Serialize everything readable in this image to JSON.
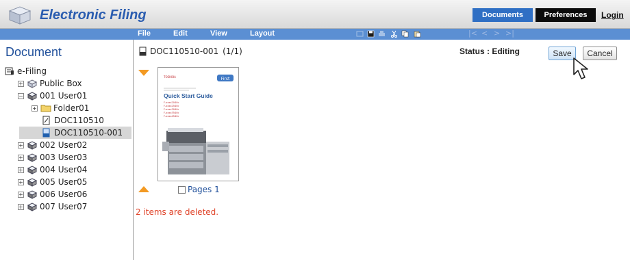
{
  "header": {
    "app_title": "Electronic Filing",
    "nav": {
      "documents": "Documents",
      "preferences": "Preferences",
      "login": "Login"
    },
    "colors": {
      "title_blue": "#2b5db0",
      "documents_tab": "#2f6fc4",
      "preferences_tab": "#0b0b0b"
    }
  },
  "menubar": {
    "items": [
      "File",
      "Edit",
      "View",
      "Layout"
    ],
    "toolbar_icons": [
      "unknown-icon",
      "save-icon",
      "print-icon",
      "cut-icon",
      "copy-icon",
      "paste-icon"
    ],
    "page_nav": [
      "|<",
      "<",
      ">",
      ">|"
    ],
    "color": "#5b8fd3"
  },
  "sidebar": {
    "title": "Document",
    "tree": [
      {
        "label": "e-Filing",
        "icon": "efiling-icon",
        "expander": ""
      },
      {
        "label": "Public Box",
        "icon": "box-icon",
        "expander": "+"
      },
      {
        "label": "001 User01",
        "icon": "user-box-icon",
        "expander": "−"
      },
      {
        "label": "Folder01",
        "icon": "folder-icon",
        "expander": "+"
      },
      {
        "label": "DOC110510",
        "icon": "document-icon",
        "expander": ""
      },
      {
        "label": "DOC110510-001",
        "icon": "document-edit-icon",
        "expander": "",
        "selected": true
      },
      {
        "label": "002 User02",
        "icon": "user-box-icon",
        "expander": "+"
      },
      {
        "label": "003 User03",
        "icon": "user-box-icon",
        "expander": "+"
      },
      {
        "label": "004 User04",
        "icon": "user-box-icon",
        "expander": "+"
      },
      {
        "label": "005 User05",
        "icon": "user-box-icon",
        "expander": "+"
      },
      {
        "label": "006 User06",
        "icon": "user-box-icon",
        "expander": "+"
      },
      {
        "label": "007 User07",
        "icon": "user-box-icon",
        "expander": "+"
      }
    ]
  },
  "main": {
    "document_title": "DOC110510-001",
    "page_count": "(1/1)",
    "status": "Status : Editing",
    "save_label": "Save",
    "cancel_label": "Cancel",
    "page_checkbox_label": "Pages 1",
    "page_checked": false,
    "message": "2 items are deleted.",
    "thumbnail": {
      "brand": "TOSHIBA",
      "badge": "First",
      "title": "Quick Start Guide",
      "models": [
        "F-xxxx2040c",
        "F-xxxx2540c",
        "F-xxxx3040c",
        "F-xxxx3540c",
        "F-xxxx4540c"
      ]
    }
  }
}
